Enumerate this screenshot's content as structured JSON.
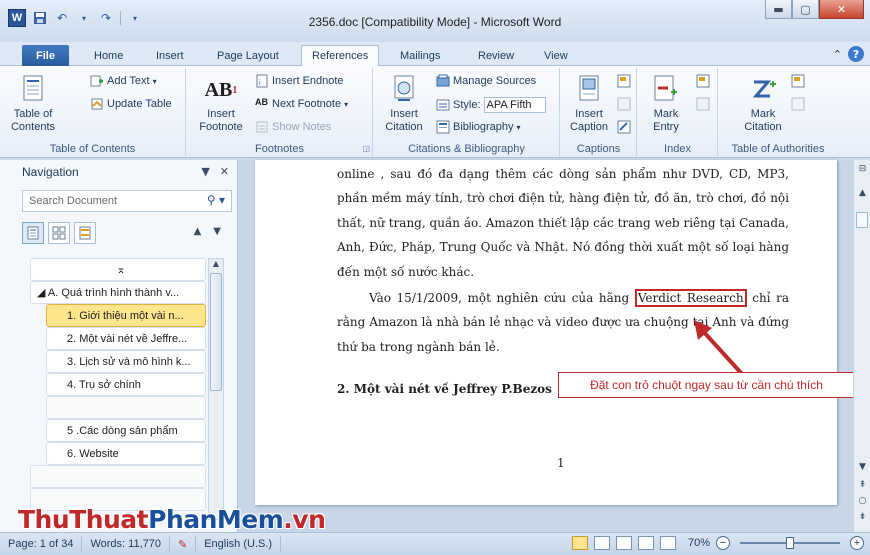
{
  "window": {
    "title": "2356.doc [Compatibility Mode] - Microsoft Word",
    "logo_letter": "W"
  },
  "tabs": [
    "File",
    "Home",
    "Insert",
    "Page Layout",
    "References",
    "Mailings",
    "Review",
    "View"
  ],
  "active_tab": "References",
  "ribbon": {
    "toc": {
      "big_label": "Table of\nContents",
      "add_text": "Add Text",
      "update_table": "Update Table",
      "group_label": "Table of Contents"
    },
    "footnotes": {
      "insert_footnote": "Insert\nFootnote",
      "insert_endnote": "Insert Endnote",
      "next_footnote": "Next Footnote",
      "show_notes": "Show Notes",
      "group_label": "Footnotes"
    },
    "citations": {
      "insert_citation": "Insert\nCitation",
      "manage_sources": "Manage Sources",
      "style_label": "Style:",
      "style_value": "APA Fifth",
      "bibliography": "Bibliography",
      "group_label": "Citations & Bibliography"
    },
    "captions": {
      "insert_caption": "Insert\nCaption",
      "group_label": "Captions"
    },
    "index": {
      "mark_entry": "Mark\nEntry",
      "group_label": "Index"
    },
    "toa": {
      "mark_citation": "Mark\nCitation",
      "group_label": "Table of Authorities"
    }
  },
  "navigation": {
    "title": "Navigation",
    "search_placeholder": "Search Document",
    "items": [
      {
        "label": "⌅",
        "level": 0,
        "kind": "collapse"
      },
      {
        "label": "◢ A. Quá trình hình thành v...",
        "level": 1,
        "kind": "item"
      },
      {
        "label": "1. Giới thiệu một vài n...",
        "level": 2,
        "kind": "selected"
      },
      {
        "label": "2. Một vài nét về Jeffre...",
        "level": 2,
        "kind": "item"
      },
      {
        "label": "3. Lịch sử và mô hình k...",
        "level": 2,
        "kind": "item"
      },
      {
        "label": "4. Trụ sở chính",
        "level": 2,
        "kind": "item"
      },
      {
        "label": "",
        "level": 2,
        "kind": "blank"
      },
      {
        "label": "5 .Các dòng sản phẩm",
        "level": 2,
        "kind": "item"
      },
      {
        "label": "6. Website",
        "level": 2,
        "kind": "item"
      },
      {
        "label": "",
        "level": 0,
        "kind": "blank"
      },
      {
        "label": "",
        "level": 0,
        "kind": "blank"
      }
    ]
  },
  "document": {
    "para1": "online , sau đó đa dạng thêm các dòng sản phẩm như DVD, CD, MP3, phần mềm máy tính, trò chơi điện tử, hàng điện tử, đồ ăn, trò chơi, đồ nội thất, nữ trang, quần áo. Amazon thiết lập các trang web riêng tại Canada, Anh, Đức, Pháp, Trung Quốc và Nhật. Nó đồng thời xuất một số loại hàng đến một số nước khác.",
    "para2_before": "Vào 15/1/2009, một nghiên cứu của hãng ",
    "para2_highlight": "Verdict Research",
    "para2_after": " chỉ ra rằng Amazon là nhà bán lẻ nhạc và video được ưa chuộng tại Anh và đứng thứ ba trong ngành bán lẻ.",
    "heading": "2. Một vài nét về Jeffrey P.Bezos",
    "page_number": "1"
  },
  "annotation": {
    "text": "Đặt con trỏ chuột ngay sau từ cần chú thích",
    "color": "#c0292a"
  },
  "statusbar": {
    "page": "Page: 1 of 34",
    "words": "Words: 11,770",
    "language": "English (U.S.)",
    "zoom": "70%"
  },
  "watermark": {
    "part1": "ThuThuat",
    "part2": "PhanMem",
    "part3": ".vn"
  }
}
